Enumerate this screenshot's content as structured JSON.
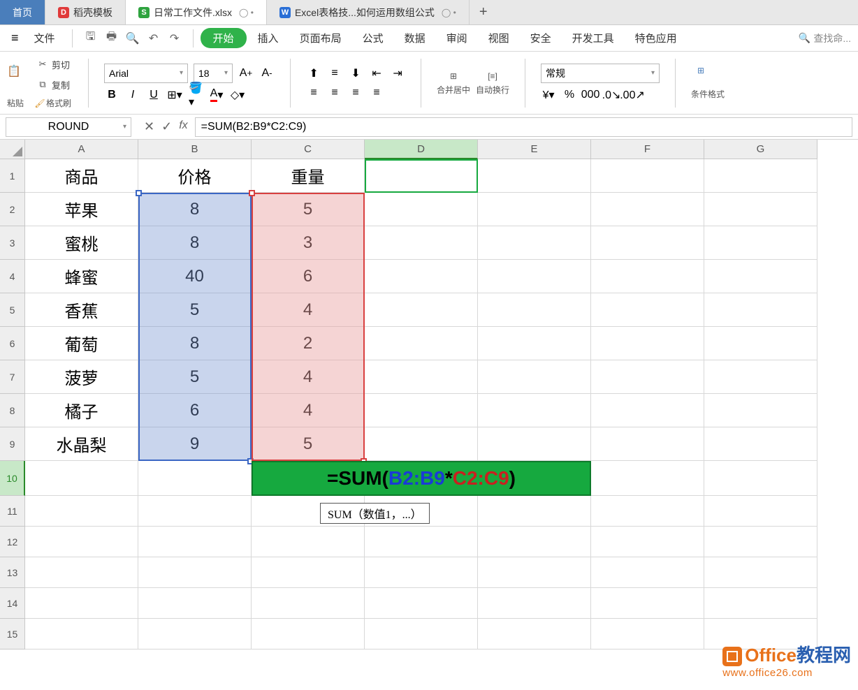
{
  "tabs": {
    "home": "首页",
    "t1": {
      "icon_bg": "#e03a3a",
      "icon_txt": "D",
      "label": "稻壳模板"
    },
    "t2": {
      "icon_bg": "#2fa33f",
      "icon_txt": "S",
      "label": "日常工作文件.xlsx"
    },
    "t3": {
      "icon_bg": "#2a6fd6",
      "icon_txt": "W",
      "label": "Excel表格技...如何运用数组公式"
    }
  },
  "menu": {
    "file": "文件",
    "items": [
      "开始",
      "插入",
      "页面布局",
      "公式",
      "数据",
      "审阅",
      "视图",
      "安全",
      "开发工具",
      "特色应用"
    ],
    "search": "查找命..."
  },
  "ribbon": {
    "paste": "粘贴",
    "cut": "剪切",
    "copy": "复制",
    "format_painter": "格式刷",
    "font": "Arial",
    "font_size": "18",
    "merge": "合并居中",
    "wrap": "自动换行",
    "numfmt": "常规",
    "cond_fmt": "条件格式"
  },
  "name_box": "ROUND",
  "formula_bar": "=SUM(B2:B9*C2:C9)",
  "columns": [
    "A",
    "B",
    "C",
    "D",
    "E",
    "F",
    "G"
  ],
  "rows": [
    "1",
    "2",
    "3",
    "4",
    "5",
    "6",
    "7",
    "8",
    "9",
    "10",
    "11",
    "12",
    "13",
    "14",
    "15"
  ],
  "table": {
    "headers": {
      "A": "商品",
      "B": "价格",
      "C": "重量"
    },
    "data": [
      {
        "A": "苹果",
        "B": "8",
        "C": "5"
      },
      {
        "A": "蜜桃",
        "B": "8",
        "C": "3"
      },
      {
        "A": "蜂蜜",
        "B": "40",
        "C": "6"
      },
      {
        "A": "香蕉",
        "B": "5",
        "C": "4"
      },
      {
        "A": "葡萄",
        "B": "8",
        "C": "2"
      },
      {
        "A": "菠萝",
        "B": "5",
        "C": "4"
      },
      {
        "A": "橘子",
        "B": "6",
        "C": "4"
      },
      {
        "A": "水晶梨",
        "B": "9",
        "C": "5"
      }
    ]
  },
  "formula_cell": {
    "prefix": "=SUM(",
    "range1": " B2:B9 ",
    "op": "*",
    "range2": " C2:C9 ",
    "suffix": ")"
  },
  "tooltip": "SUM（数值1，...）",
  "watermark": {
    "brand1": "Office",
    "brand2": "教程网",
    "url": "www.office26.com"
  }
}
